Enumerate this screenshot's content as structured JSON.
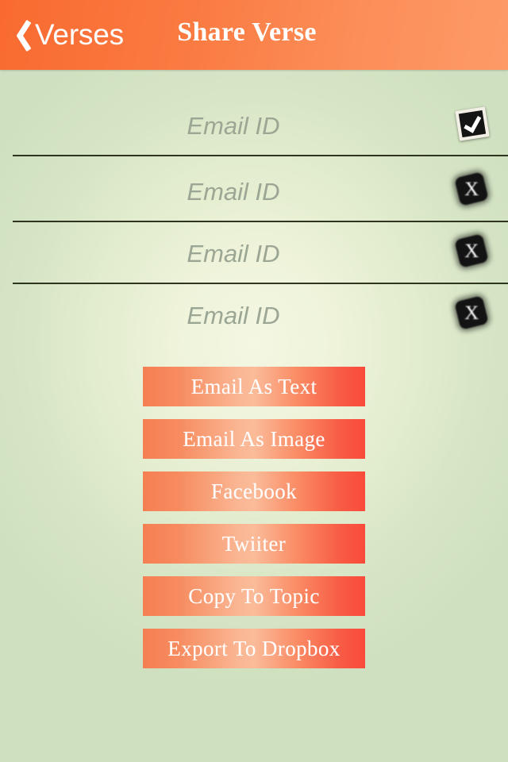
{
  "header": {
    "back_label": "Verses",
    "back_icon": "chevron-left-icon",
    "title": "Share Verse"
  },
  "recipients": {
    "placeholder": "Email ID",
    "rows": [
      {
        "value": "",
        "placeholder": "Email ID",
        "status_icon": "checkbox-checked-icon",
        "status_glyph": ""
      },
      {
        "value": "",
        "placeholder": "Email ID",
        "status_icon": "close-x-icon",
        "status_glyph": "X"
      },
      {
        "value": "",
        "placeholder": "Email ID",
        "status_icon": "close-x-icon",
        "status_glyph": "X"
      },
      {
        "value": "",
        "placeholder": "Email ID",
        "status_icon": "close-x-icon",
        "status_glyph": "X"
      }
    ]
  },
  "actions": [
    {
      "label": "Email As Text"
    },
    {
      "label": "Email As Image"
    },
    {
      "label": "Facebook"
    },
    {
      "label": "Twiiter"
    },
    {
      "label": "Copy To Topic"
    },
    {
      "label": "Export To Dropbox"
    }
  ],
  "colors": {
    "navbar_left": "#f96a30",
    "navbar_right": "#fd9a67",
    "button_left": "#f57f53",
    "button_mid": "#fbbb99",
    "button_right": "#f94a3c",
    "background_edge": "#cee0bf",
    "background_center": "#f4f7e2",
    "separator": "#20250f",
    "placeholder_text": "#9ba694"
  }
}
